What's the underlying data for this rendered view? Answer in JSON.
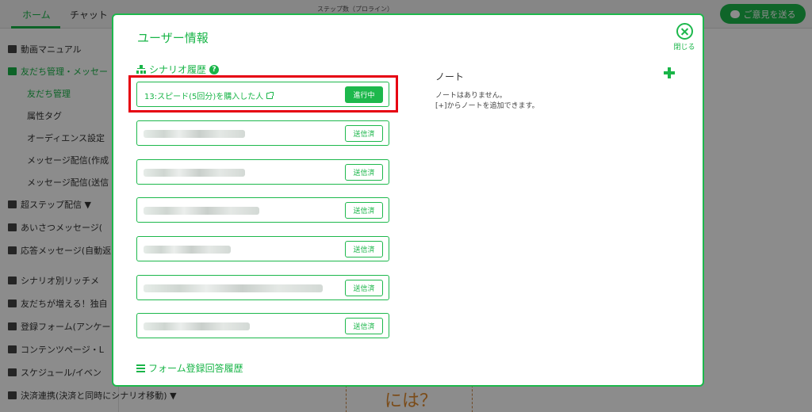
{
  "topbar": {
    "tabs": [
      "ホーム",
      "チャット"
    ],
    "center_title": "ステップ数（プロライン）",
    "feedback_label": "ご意見を送る"
  },
  "sidebar": {
    "items": [
      {
        "label": "動画マニュアル",
        "icon": "video-icon"
      },
      {
        "label": "友だち管理・メッセー",
        "icon": "person-card-icon"
      },
      {
        "label": "友だち管理"
      },
      {
        "label": "属性タグ"
      },
      {
        "label": "オーディエンス設定"
      },
      {
        "label": "メッセージ配信(作成"
      },
      {
        "label": "メッセージ配信(送信"
      },
      {
        "label": "超ステップ配信 ▼",
        "icon": "tree-icon"
      },
      {
        "label": "あいさつメッセージ(",
        "icon": "hand-icon"
      },
      {
        "label": "応答メッセージ(自動返",
        "icon": "reply-icon"
      },
      {
        "label": "シナリオ別リッチメ",
        "icon": "phone-icon"
      },
      {
        "label": "友だちが増える！独自",
        "icon": "people-icon"
      },
      {
        "label": "登録フォーム(アンケー",
        "icon": "list-icon"
      },
      {
        "label": "コンテンツページ・L",
        "icon": "globe-icon"
      },
      {
        "label": "スケジュール/イベン",
        "icon": "calendar-icon"
      },
      {
        "label": "決済連携(決済と同時にシナリオ移動) ▼",
        "icon": "card-icon"
      }
    ]
  },
  "background": {
    "card_text": "には？"
  },
  "modal": {
    "title": "ユーザー情報",
    "close_label": "閉じる",
    "scenario_heading": "シナリオ履歴",
    "scenarios": [
      {
        "name": "13:スピード(5回分)を購入した人",
        "status": "進行中"
      },
      {
        "name": "",
        "status": "送信済"
      },
      {
        "name": "",
        "status": "送信済"
      },
      {
        "name": "",
        "status": "送信済"
      },
      {
        "name": "",
        "status": "送信済"
      },
      {
        "name": "",
        "status": "送信済"
      },
      {
        "name": "",
        "status": "送信済"
      }
    ],
    "form_history_label": "フォーム登録回答履歴",
    "note": {
      "title": "ノート",
      "empty_line1": "ノートはありません。",
      "empty_line2": "[+]からノートを追加できます。"
    }
  }
}
